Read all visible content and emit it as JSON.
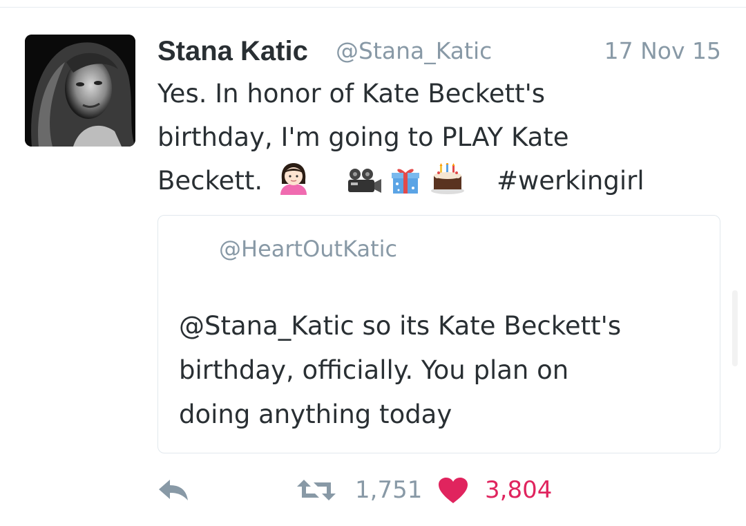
{
  "tweet": {
    "author_name": "Stana Katic",
    "author_handle": "@Stana_Katic",
    "timestamp": "17 Nov 15",
    "text_lines": [
      "Yes. In honor of Kate Beckett's",
      "birthday, I'm going to PLAY Kate",
      "Beckett."
    ],
    "emojis": [
      "girl-emoji",
      "movie-camera-emoji",
      "wrapped-gift-emoji",
      "birthday-cake-emoji"
    ],
    "hashtag": "#werkingirl"
  },
  "quoted_tweet": {
    "handle": "@HeartOutKatic",
    "text_lines": [
      "@Stana_Katic so its Kate Beckett's",
      "birthday, officially. You plan on",
      "doing anything today"
    ]
  },
  "actions": {
    "reply_icon": "reply-icon",
    "retweet_icon": "retweet-icon",
    "retweet_count": "1,751",
    "like_icon": "heart-icon",
    "like_count": "3,804"
  },
  "colors": {
    "text": "#292f33",
    "secondary": "#8899a6",
    "like": "#e0245e",
    "border": "#e1e8ed"
  }
}
